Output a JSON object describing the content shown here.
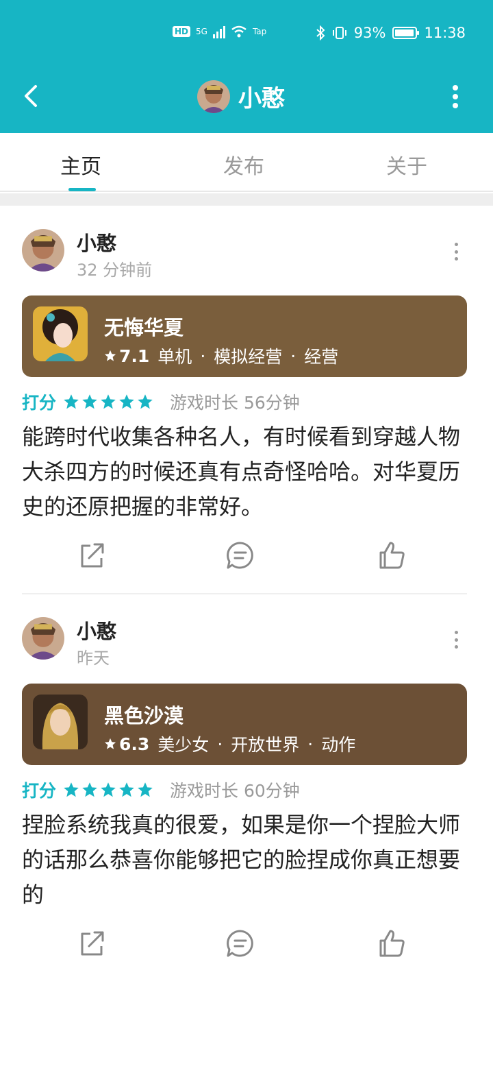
{
  "status_bar": {
    "hd": "HD",
    "network": "5G",
    "wifi_label": "Tap",
    "battery": "93%",
    "time": "11:38",
    "battery_level": 0.93
  },
  "nav": {
    "title": "小憨"
  },
  "tabs": [
    {
      "label": "主页"
    },
    {
      "label": "发布"
    },
    {
      "label": "关于"
    }
  ],
  "posts": [
    {
      "author": "小憨",
      "time": "32 分钟前",
      "game": {
        "name": "无悔华夏",
        "score": "7.1",
        "tags": [
          "单机",
          "模拟经营",
          "经营"
        ],
        "card_color": "#7a5e3c"
      },
      "rating_label": "打分",
      "stars": 5,
      "playtime": "游戏时长 56分钟",
      "review": "能跨时代收集各种名人，有时候看到穿越人物大杀四方的时候还真有点奇怪哈哈。对华夏历史的还原把握的非常好。"
    },
    {
      "author": "小憨",
      "time": "昨天",
      "game": {
        "name": "黑色沙漠",
        "score": "6.3",
        "tags": [
          "美少女",
          "开放世界",
          "动作"
        ],
        "card_color": "#6c5036"
      },
      "rating_label": "打分",
      "stars": 5,
      "playtime": "游戏时长 60分钟",
      "review": "捏脸系统我真的很爱，如果是你一个捏脸大师的话那么恭喜你能够把它的脸捏成你真正想要的"
    }
  ],
  "colors": {
    "accent": "#17b5c4",
    "header": "#17b5c4"
  }
}
